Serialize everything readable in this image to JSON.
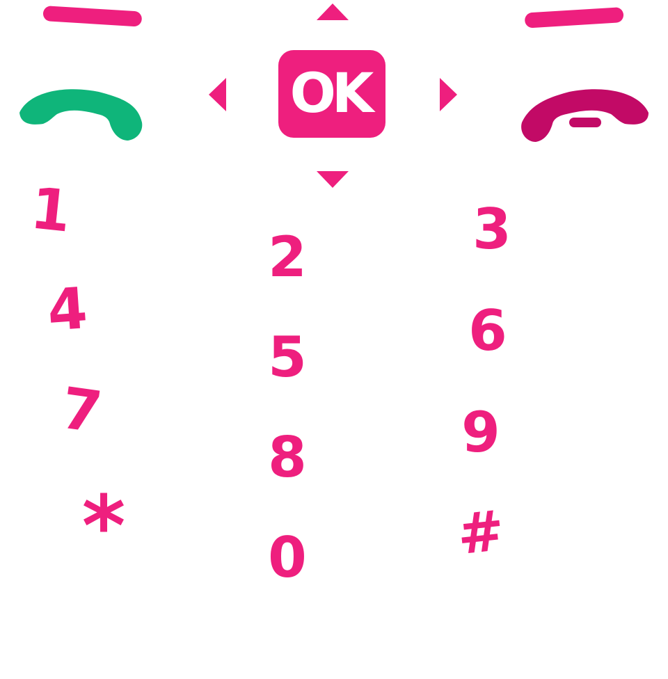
{
  "ok_button": {
    "label": "OK"
  },
  "keypad": {
    "keys": [
      {
        "id": "1",
        "label": "1"
      },
      {
        "id": "2",
        "label": "2"
      },
      {
        "id": "3",
        "label": "3"
      },
      {
        "id": "4",
        "label": "4"
      },
      {
        "id": "5",
        "label": "5"
      },
      {
        "id": "6",
        "label": "6"
      },
      {
        "id": "7",
        "label": "7"
      },
      {
        "id": "8",
        "label": "8"
      },
      {
        "id": "9",
        "label": "9"
      },
      {
        "id": "star",
        "label": "*"
      },
      {
        "id": "0",
        "label": "0"
      },
      {
        "id": "hash",
        "label": "#"
      }
    ]
  },
  "icons": {
    "left_softkey": "left-softkey-bar",
    "right_softkey": "right-softkey-bar",
    "call": "call-icon",
    "end_call": "end-call-icon",
    "up": "arrow-up-icon",
    "down": "arrow-down-icon",
    "left": "arrow-left-icon",
    "right": "arrow-right-icon"
  },
  "colors": {
    "accent": "#ee1f7e",
    "call_green": "#0fb57a",
    "end_call": "#c20a66",
    "background": "#ffffff"
  }
}
